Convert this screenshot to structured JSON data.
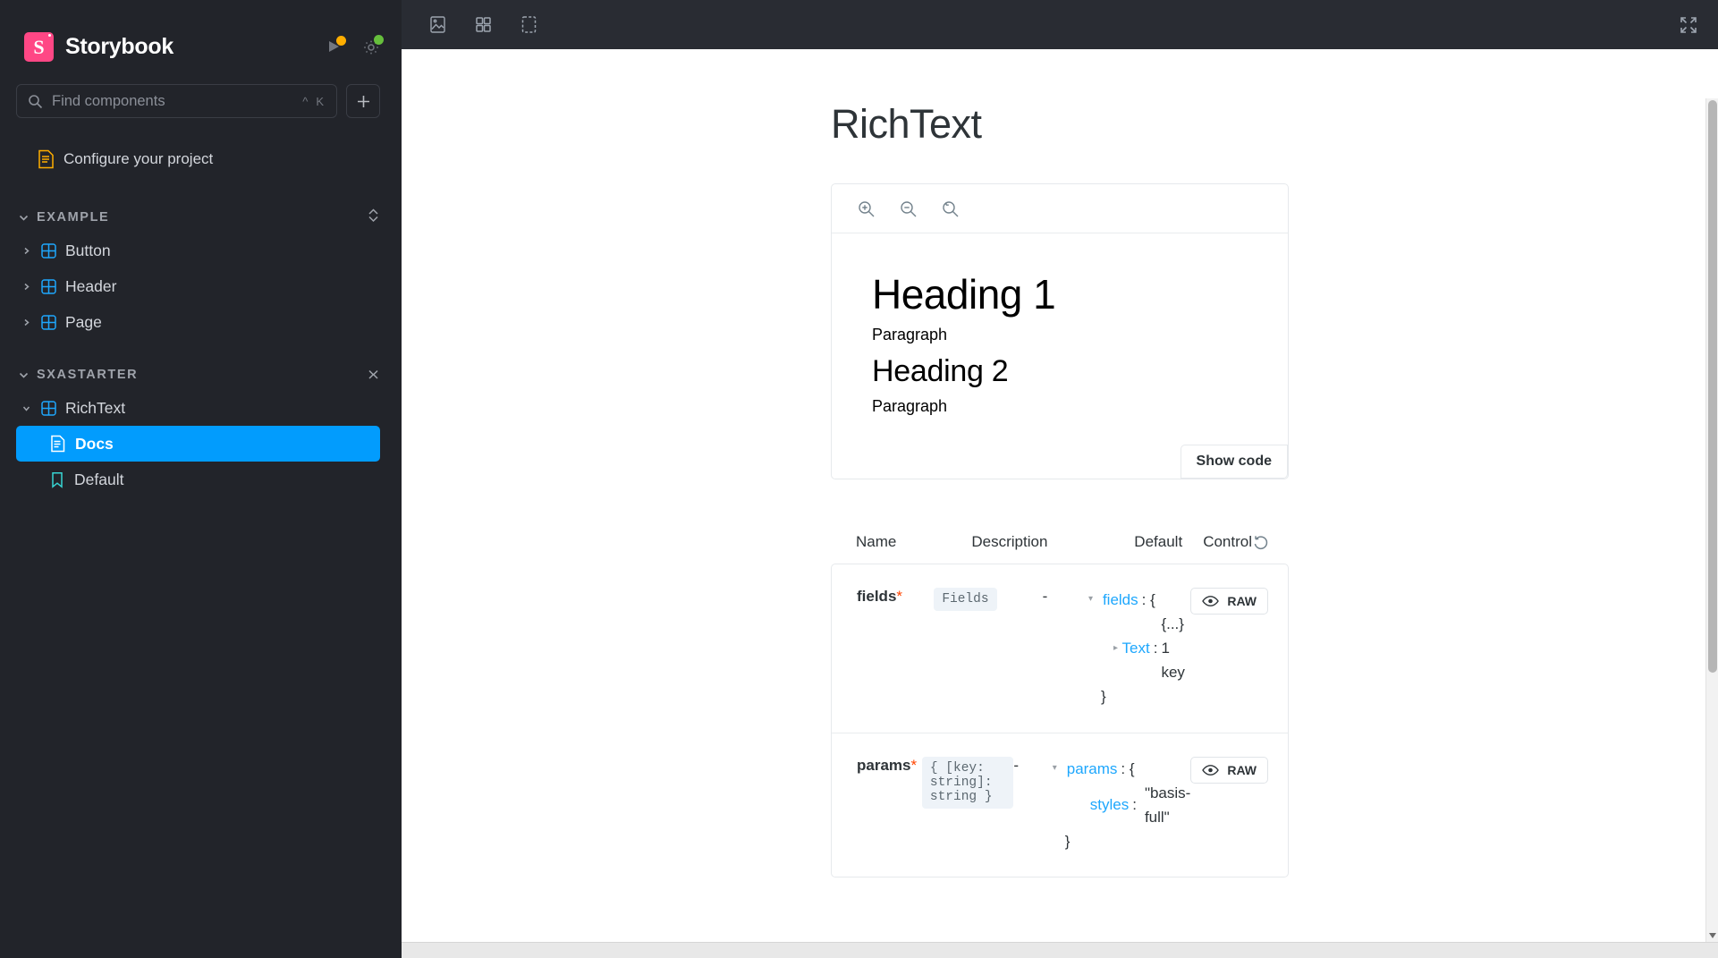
{
  "sidebar": {
    "brand": {
      "logo_letter": "S",
      "title": "Storybook"
    },
    "actions": [
      {
        "name": "shortcuts-icon",
        "badge": "#FFAE00"
      },
      {
        "name": "settings-icon",
        "badge": "#66BF3C"
      }
    ],
    "search": {
      "placeholder": "Find components",
      "shortcut_mod": "^",
      "shortcut_key": "K"
    },
    "add_button_label": "+",
    "configure": {
      "label": "Configure your project",
      "icon": "document-icon"
    },
    "sections": [
      {
        "label": "EXAMPLE",
        "expanded": true,
        "items": [
          {
            "label": "Button",
            "icon": "component-icon",
            "expanded": false
          },
          {
            "label": "Header",
            "icon": "component-icon",
            "expanded": false
          },
          {
            "label": "Page",
            "icon": "component-icon",
            "expanded": false
          }
        ]
      },
      {
        "label": "SXASTARTER",
        "expanded": true,
        "items": [
          {
            "label": "RichText",
            "icon": "component-icon",
            "expanded": true,
            "children": [
              {
                "label": "Docs",
                "icon": "docs-icon",
                "selected": true
              },
              {
                "label": "Default",
                "icon": "story-icon",
                "selected": false
              }
            ]
          }
        ]
      }
    ]
  },
  "topbar": {
    "tools": [
      {
        "name": "background-icon"
      },
      {
        "name": "grid-icon"
      },
      {
        "name": "measure-icon"
      }
    ],
    "fullscreen": {
      "name": "fullscreen-icon"
    }
  },
  "docs": {
    "title": "RichText",
    "preview_toolbar": [
      {
        "name": "zoom-in-icon"
      },
      {
        "name": "zoom-out-icon"
      },
      {
        "name": "zoom-reset-icon"
      }
    ],
    "preview": {
      "heading1": "Heading 1",
      "paragraph1": "Paragraph",
      "heading2": "Heading 2",
      "paragraph2": "Paragraph"
    },
    "show_code_label": "Show code"
  },
  "args_table": {
    "columns": {
      "name": "Name",
      "description": "Description",
      "default": "Default",
      "control": "Control"
    },
    "reset_icon": "reset-controls-icon",
    "rows": [
      {
        "name": "fields",
        "required": "*",
        "description": "Fields",
        "default": "-",
        "raw_label": "RAW",
        "control": {
          "open_key": "fields",
          "open_punct": ": {",
          "child_key": "Text",
          "child_punct": ":",
          "child_value": "{...} 1 key",
          "close_punct": "}"
        }
      },
      {
        "name": "params",
        "required": "*",
        "description": "{ [key: string]: string }",
        "default": "-",
        "raw_label": "RAW",
        "control": {
          "open_key": "params",
          "open_punct": ": {",
          "child_key": "styles",
          "child_punct": ":",
          "child_value": "\"basis-full\"",
          "close_punct": "}"
        }
      }
    ]
  },
  "colors": {
    "accent_blue": "#029CFD",
    "brand_pink": "#FF4785",
    "link_blue": "#1EA7FD",
    "required_orange": "#FF4400",
    "sidebar_bg": "#22242A",
    "topbar_bg": "#292C33"
  }
}
